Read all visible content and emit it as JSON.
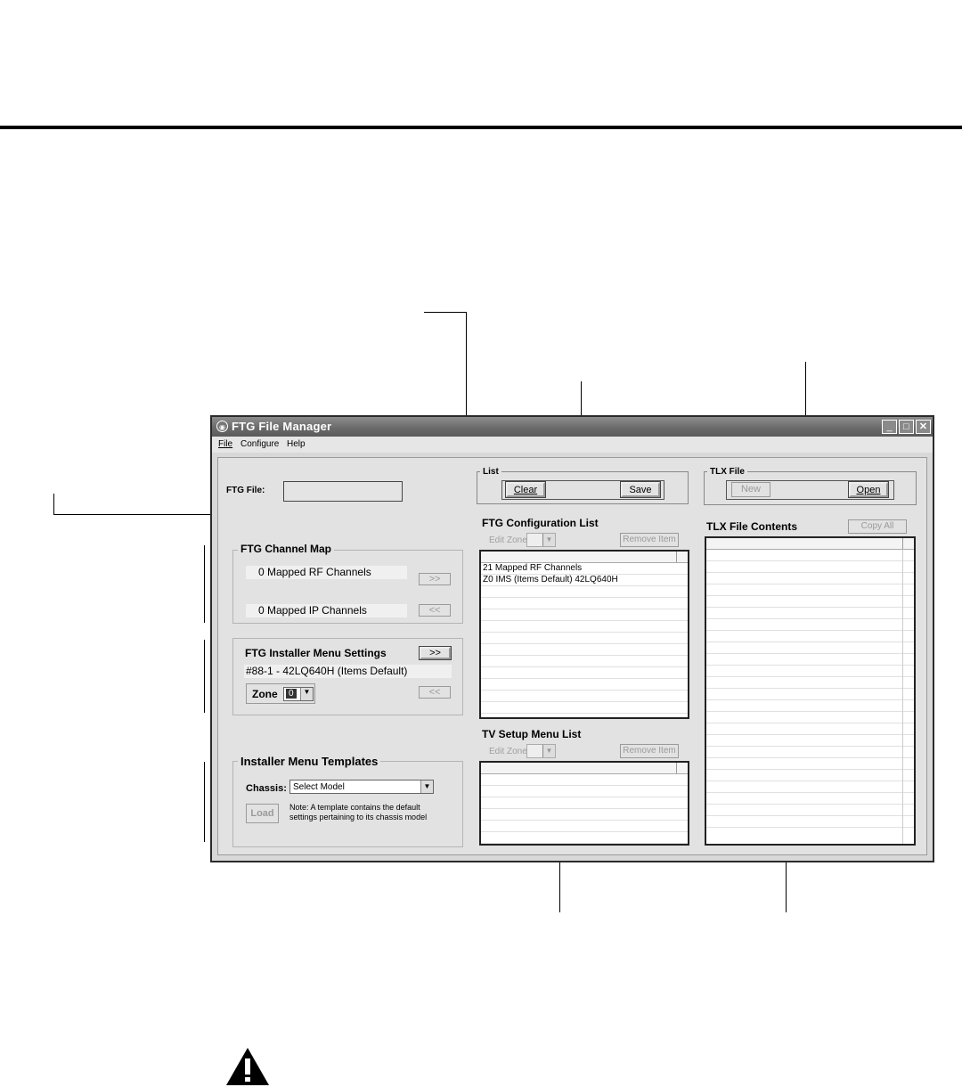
{
  "window": {
    "title": "FTG File Manager",
    "controls": {
      "minimize": "_",
      "maximize": "□",
      "close": "✕"
    }
  },
  "menu": {
    "items": [
      "File",
      "Configure",
      "Help"
    ]
  },
  "ftg_file": {
    "label": "FTG File:",
    "value": ""
  },
  "channel_map": {
    "title": "FTG Channel Map",
    "rf_text": "0 Mapped RF Channels",
    "ip_text": "0 Mapped IP Channels",
    "forward_label": ">>",
    "back_label": "<<"
  },
  "installer_settings": {
    "title": "FTG Installer Menu Settings",
    "forward_label": ">>",
    "back_label": "<<",
    "item_text": "#88-1 - 42LQ640H (Items Default)",
    "zone_label": "Zone",
    "zone_value": "0"
  },
  "templates": {
    "title": "Installer Menu Templates",
    "chassis_label": "Chassis:",
    "chassis_value": "Select Model",
    "load_label": "Load",
    "note_line1": "Note:  A template contains the default",
    "note_line2": "settings pertaining to its chassis model"
  },
  "list_group": {
    "title": "List",
    "clear_label": "Clear",
    "save_label": "Save"
  },
  "tlx_file": {
    "title": "TLX File",
    "new_label": "New",
    "open_label": "Open"
  },
  "ftg_config_list": {
    "title": "FTG Configuration List",
    "edit_zone_label": "Edit Zone",
    "remove_label": "Remove Item",
    "items": [
      "21 Mapped RF Channels",
      "Z0 IMS (Items Default) 42LQ640H"
    ]
  },
  "tlx_contents": {
    "title": "TLX File Contents",
    "copy_all_label": "Copy All"
  },
  "tv_setup_list": {
    "title": "TV Setup Menu List",
    "edit_zone_label": "Edit Zone",
    "remove_label": "Remove Item"
  },
  "icons": {
    "warning": "warning-icon",
    "dropdown": "chevron-down-icon"
  }
}
